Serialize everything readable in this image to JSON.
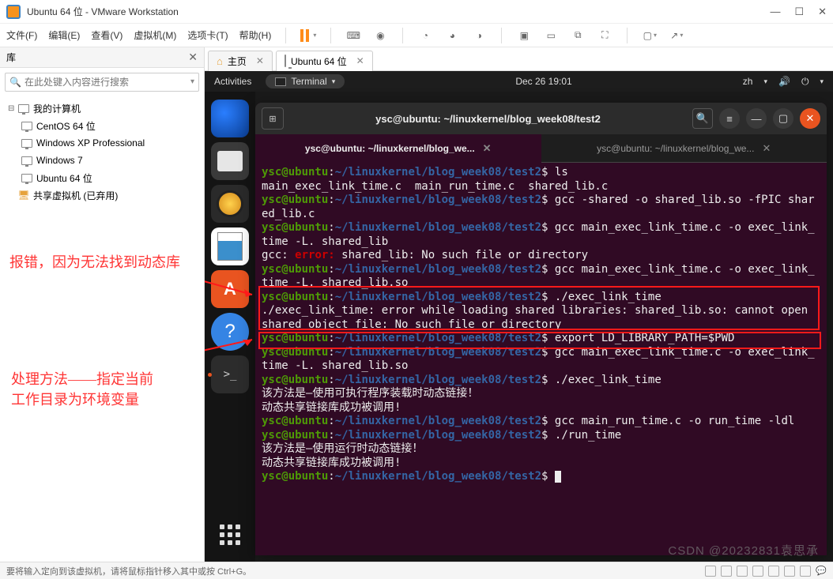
{
  "vmware": {
    "title": "Ubuntu 64 位 - VMware Workstation",
    "menu": {
      "file": "文件(F)",
      "edit": "编辑(E)",
      "view": "查看(V)",
      "vm": "虚拟机(M)",
      "tabs": "选项卡(T)",
      "help": "帮助(H)"
    },
    "library": {
      "title": "库",
      "search_placeholder": "在此处键入内容进行搜索",
      "root": "我的计算机",
      "items": [
        "CentOS 64 位",
        "Windows XP Professional",
        "Windows 7",
        "Ubuntu 64 位"
      ],
      "shared": "共享虚拟机 (已弃用)"
    },
    "tabs": {
      "home": "主页",
      "vm": "Ubuntu 64 位"
    },
    "status": "要将输入定向到该虚拟机，请将鼠标指针移入其中或按 Ctrl+G。"
  },
  "gnome": {
    "activities": "Activities",
    "app": "Terminal",
    "clock": "Dec 26  19:01",
    "lang": "zh"
  },
  "terminal": {
    "title": "ysc@ubuntu: ~/linuxkernel/blog_week08/test2",
    "tab_active": "ysc@ubuntu: ~/linuxkernel/blog_we...",
    "tab_inactive": "ysc@ubuntu: ~/linuxkernel/blog_we...",
    "prompt_user": "ysc@ubuntu",
    "prompt_path": "~/linuxkernel/blog_week08/test2",
    "lines": {
      "cmd1": "ls",
      "out1": "main_exec_link_time.c  main_run_time.c  shared_lib.c",
      "cmd2": "gcc -shared -o shared_lib.so -fPIC shared_lib.c",
      "cmd3": "gcc main_exec_link_time.c -o exec_link_time -L. shared_lib",
      "err_label": "error:",
      "err_gcc_pre": "gcc: ",
      "err_gcc": " shared_lib: No such file or directory",
      "cmd4": "gcc main_exec_link_time.c -o exec_link_time -L. shared_lib.so",
      "cmd5": "./exec_link_time",
      "err_run": "./exec_link_time: error while loading shared libraries: shared_lib.so: cannot open shared object file: No such file or directory",
      "cmd6": "export LD_LIBRARY_PATH=$PWD",
      "cmd7": "gcc main_exec_link_time.c -o exec_link_time -L. shared_lib.so",
      "cmd8": "./exec_link_time",
      "out2": "该方法是—使用可执行程序装载时动态链接！",
      "out3": "动态共享链接库成功被调用!",
      "cmd9": "gcc main_run_time.c -o run_time -ldl",
      "cmd10": "./run_time",
      "out4": "该方法是—使用运行时动态链接！",
      "out5": "动态共享链接库成功被调用!"
    }
  },
  "annotations": {
    "note1": "报错，因为无法找到动态库",
    "note2a": "处理方法——指定当前",
    "note2b": "工作目录为环境变量"
  },
  "watermark": "CSDN @20232831袁思承"
}
